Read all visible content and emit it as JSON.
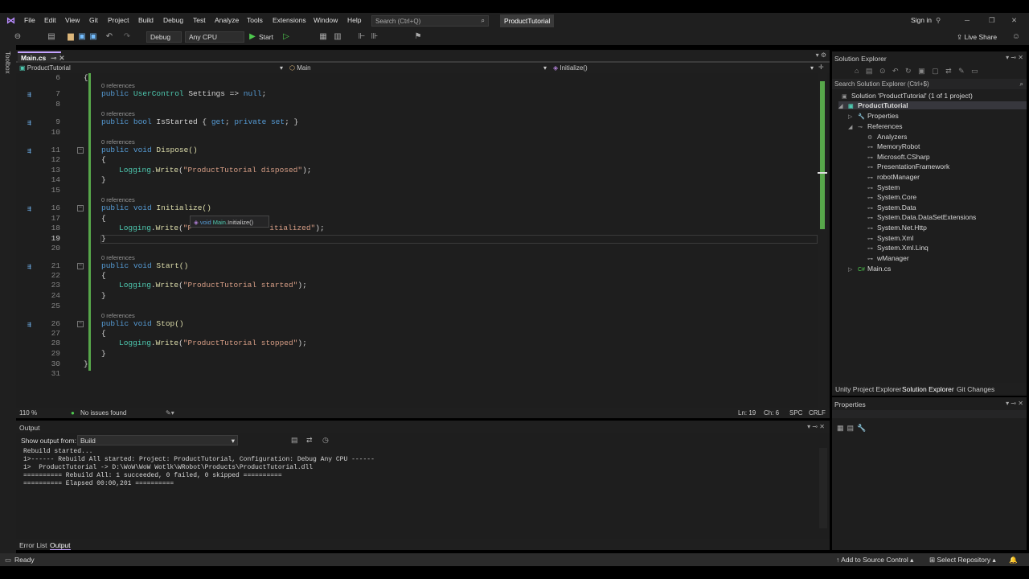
{
  "menu": {
    "items": [
      "File",
      "Edit",
      "View",
      "Git",
      "Project",
      "Build",
      "Debug",
      "Test",
      "Analyze",
      "Tools",
      "Extensions",
      "Window",
      "Help"
    ],
    "search_placeholder": "Search (Ctrl+Q)",
    "project_badge": "ProductTutorial",
    "sign_in": "Sign in",
    "live_share": "Live Share"
  },
  "toolbar": {
    "config": "Debug",
    "platform": "Any CPU",
    "start_label": "Start"
  },
  "toolbox_label": "Toolbox",
  "editor": {
    "tab_label": "Main.cs",
    "nav_project": "ProductTutorial",
    "nav_class": "Main",
    "nav_member": "Initialize()",
    "lines": [
      {
        "num": "6",
        "ref": "",
        "text": "{",
        "indent": ""
      },
      {
        "num": "7",
        "ref": "0 references",
        "kind": "prop"
      },
      {
        "num": "9",
        "ref": "0 references",
        "kind": "prop2"
      },
      {
        "num": "10"
      },
      {
        "num": "11",
        "ref": "0 references"
      },
      {
        "num": "12"
      },
      {
        "num": "13"
      },
      {
        "num": "14"
      },
      {
        "num": "15"
      },
      {
        "num": "16",
        "ref": "0 references"
      },
      {
        "num": "17"
      },
      {
        "num": "18"
      },
      {
        "num": "19"
      },
      {
        "num": "20"
      },
      {
        "num": "21",
        "ref": "0 references"
      },
      {
        "num": "22"
      },
      {
        "num": "23"
      },
      {
        "num": "24"
      },
      {
        "num": "25"
      },
      {
        "num": "26",
        "ref": "0 references"
      },
      {
        "num": "27"
      },
      {
        "num": "28"
      },
      {
        "num": "29"
      },
      {
        "num": "30"
      },
      {
        "num": "31"
      },
      {
        "num": "8"
      }
    ],
    "ref_label": "0 references",
    "code": {
      "l7_kw": "public",
      "l7_type": "UserControl",
      "l7_rest": " Settings => ",
      "l7_null": "null",
      "l7_end": ";",
      "l9_kw": "public bool",
      "l9_rest": " IsStarted { ",
      "l9_get": "get",
      "l9_mid": "; ",
      "l9_set": "private set",
      "l9_end": "; }",
      "l11_kw": "public void",
      "l11_rest": " Dispose()",
      "l13_cls": "Logging",
      "l13_fn": "Write",
      "l13_str": "\"ProductTutorial disposed\"",
      "l16_kw": "public void",
      "l16_rest": " Initialize()",
      "l18_cls": "Logging",
      "l18_fn": "Write",
      "l18_str_a": "\"P",
      "l18_str_b": "itialized\"",
      "l21_kw": "public void",
      "l21_rest": " Start()",
      "l23_cls": "Logging",
      "l23_fn": "Write",
      "l23_str": "\"ProductTutorial started\"",
      "l26_kw": "public void",
      "l26_rest": " Stop()",
      "l28_cls": "Logging",
      "l28_fn": "Write",
      "l28_str": "\"ProductTutorial stopped\"",
      "open_brace": "{",
      "close_brace": "}"
    },
    "tooltip": {
      "kw": "void",
      "cls": "Main",
      "member": ".Initialize()"
    },
    "status": {
      "zoom": "110 %",
      "issues": "No issues found",
      "ln": "Ln: 19",
      "ch": "Ch: 6",
      "spc": "SPC",
      "crlf": "CRLF"
    }
  },
  "output": {
    "title": "Output",
    "show_from_label": "Show output from:",
    "source": "Build",
    "lines": [
      "Rebuild started...",
      "1>------ Rebuild All started: Project: ProductTutorial, Configuration: Debug Any CPU ------",
      "1>  ProductTutorial -> D:\\WoW\\WoW Wotlk\\WRobot\\Products\\ProductTutorial.dll",
      "========== Rebuild All: 1 succeeded, 0 failed, 0 skipped ==========",
      "========== Elapsed 00:00,201 =========="
    ]
  },
  "bottom_tabs": [
    "Error List",
    "Output"
  ],
  "statusbar": {
    "ready": "Ready",
    "source_control": "Add to Source Control",
    "repo": "Select Repository"
  },
  "solution_explorer": {
    "title": "Solution Explorer",
    "search_placeholder": "Search Solution Explorer (Ctrl+$)",
    "solution": "Solution 'ProductTutorial' (1 of 1 project)",
    "project": "ProductTutorial",
    "properties": "Properties",
    "references": "References",
    "refs": [
      "Analyzers",
      "MemoryRobot",
      "Microsoft.CSharp",
      "PresentationFramework",
      "robotManager",
      "System",
      "System.Core",
      "System.Data",
      "System.Data.DataSetExtensions",
      "System.Net.Http",
      "System.Xml",
      "System.Xml.Linq",
      "wManager"
    ],
    "main_file": "Main.cs",
    "tabs": [
      "Unity Project Explorer",
      "Solution Explorer",
      "Git Changes"
    ]
  },
  "properties_panel": {
    "title": "Properties"
  },
  "colors": {
    "accent": "#c4a3ff",
    "green_margin": "#57a64a",
    "keyword": "#569cd6",
    "type": "#4ec9b0",
    "string": "#d69d85"
  }
}
